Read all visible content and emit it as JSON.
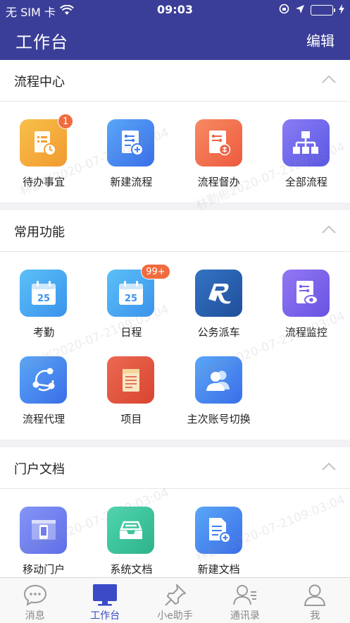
{
  "status_bar": {
    "carrier": "无 SIM 卡",
    "time": "09:03"
  },
  "header": {
    "title": "工作台",
    "edit_label": "编辑"
  },
  "sections": [
    {
      "title": "流程中心",
      "items": [
        {
          "label": "待办事宜",
          "icon": "todo-clock-icon",
          "badge": "1",
          "color": "#f5a93a"
        },
        {
          "label": "新建流程",
          "icon": "new-process-icon",
          "color": "#3f8cf3"
        },
        {
          "label": "流程督办",
          "icon": "supervise-process-icon",
          "color": "#f2724e"
        },
        {
          "label": "全部流程",
          "icon": "org-chart-icon",
          "color": "#6a66e8"
        }
      ]
    },
    {
      "title": "常用功能",
      "items": [
        {
          "label": "考勤",
          "icon": "calendar-icon",
          "day": "25",
          "color": "#3fa9f0"
        },
        {
          "label": "日程",
          "icon": "calendar-icon",
          "day": "25",
          "badge": "99+",
          "color": "#3fa9f0"
        },
        {
          "label": "公务派车",
          "icon": "car-dispatch-logo-icon",
          "color": "#2b63b5"
        },
        {
          "label": "流程监控",
          "icon": "process-monitor-icon",
          "color": "#7b61ea"
        },
        {
          "label": "流程代理",
          "icon": "share-agent-icon",
          "color": "#3a8df0"
        },
        {
          "label": "项目",
          "icon": "project-notebook-icon",
          "color": "#e0523f"
        },
        {
          "label": "主次账号切换",
          "icon": "account-switch-icon",
          "color": "#3a84ee"
        }
      ]
    },
    {
      "title": "门户文档",
      "items": [
        {
          "label": "移动门户",
          "icon": "mobile-portal-icon",
          "color": "#6f7cf2"
        },
        {
          "label": "系统文档",
          "icon": "inbox-tray-icon",
          "color": "#35c39a"
        },
        {
          "label": "新建文档",
          "icon": "new-document-icon",
          "color": "#3f8cf3"
        }
      ]
    }
  ],
  "tabs": [
    {
      "label": "消息",
      "icon": "message-bubble-icon",
      "active": false
    },
    {
      "label": "工作台",
      "icon": "desktop-monitor-icon",
      "active": true
    },
    {
      "label": "小e助手",
      "icon": "pin-assistant-icon",
      "active": false
    },
    {
      "label": "通讯录",
      "icon": "contacts-icon",
      "active": false
    },
    {
      "label": "我",
      "icon": "person-icon",
      "active": false
    }
  ],
  "watermark_text": "林勤彬2020-07-2109:03:04",
  "colors": {
    "primary": "#3b3e98",
    "badge": "#f16b3f",
    "active_tab": "#3b4bc8"
  }
}
